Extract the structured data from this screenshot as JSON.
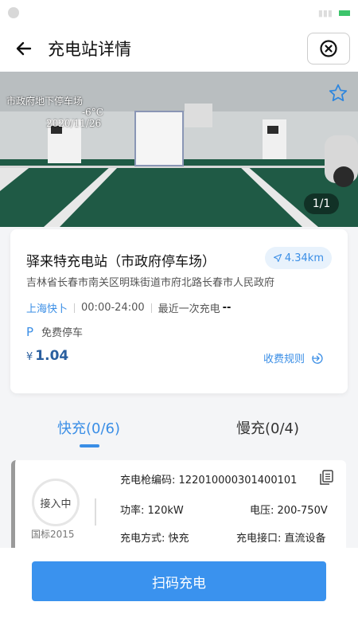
{
  "header": {
    "title": "充电站详情"
  },
  "photo": {
    "watermark_line1": "市政府地下停车场",
    "watermark_line2": "-6°C",
    "watermark_line3": "2020/11/26",
    "counter": "1/1"
  },
  "station": {
    "name": "驿来特充电站（市政府停车场）",
    "distance": "4.34km",
    "address": "吉林省长春市南关区明珠街道市府北路长春市人民政府",
    "operator": "上海快卜",
    "hours": "00:00-24:00",
    "last_charge_label": "最近一次充电",
    "last_charge_value": "--",
    "parking_icon": "P",
    "parking": "免费停车",
    "price_currency": "¥",
    "price": "1.04",
    "fee_rule": "收费规则"
  },
  "tabs": [
    {
      "label": "快充(0/6)",
      "active": true
    },
    {
      "label": "慢充(0/4)",
      "active": false
    }
  ],
  "gun": {
    "status": "接入中",
    "standard": "国标2015",
    "code_label": "充电枪编码:",
    "code_value": "122010000301400101",
    "power_label": "功率:",
    "power_value": "120kW",
    "voltage_label": "电压:",
    "voltage_value": "200-750V",
    "mode_label": "充电方式:",
    "mode_value": "快充",
    "port_label": "充电接口:",
    "port_value": "直流设备"
  },
  "bottom": {
    "scan_label": "扫码充电"
  },
  "colors": {
    "accent": "#3a8ee6",
    "button": "#3a92ee",
    "price": "#2a5f9f"
  },
  "icons": [
    "back-arrow-icon",
    "close-circle-icon",
    "star-icon",
    "location-arrow-icon",
    "parking-icon",
    "arrow-circle-right-icon",
    "copy-icon"
  ]
}
